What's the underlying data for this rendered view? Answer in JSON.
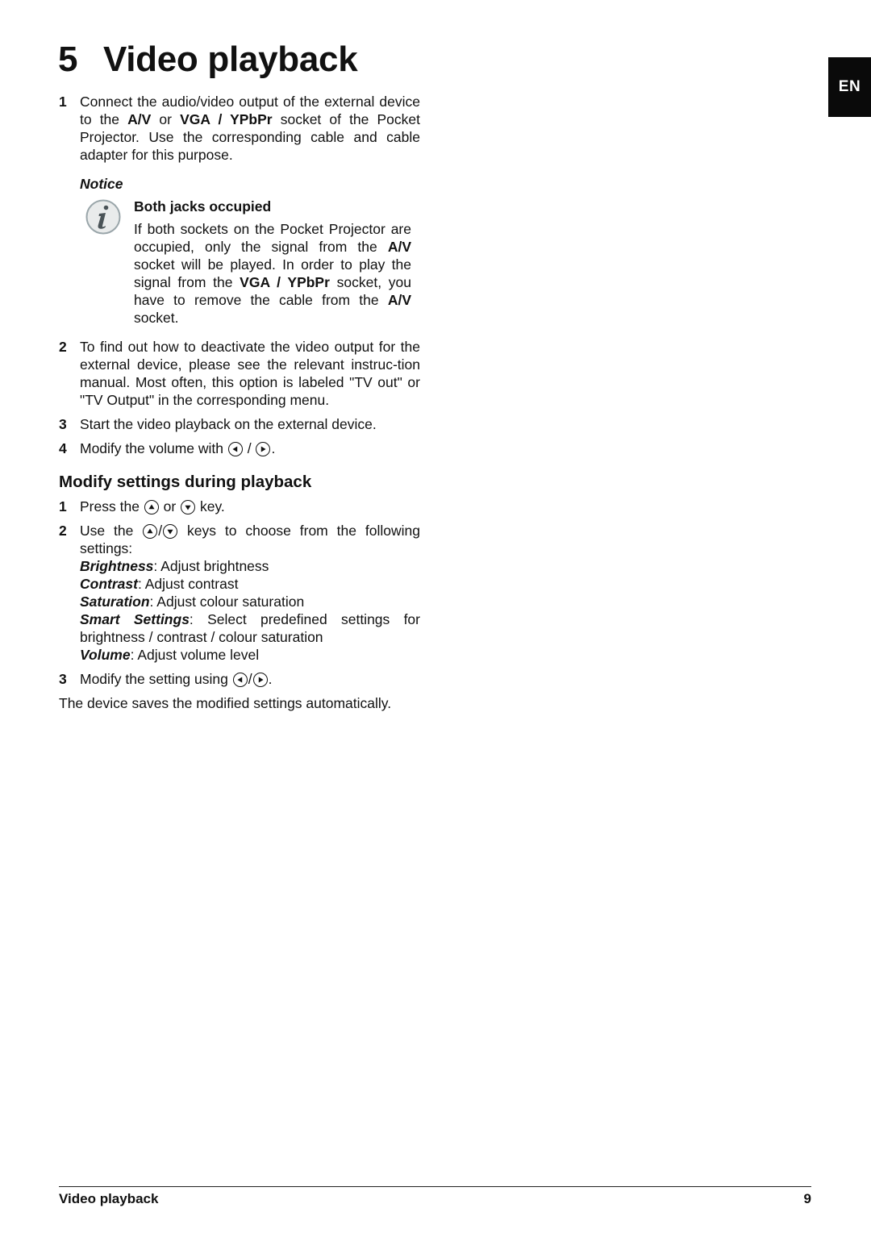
{
  "page": {
    "chapter_number": "5",
    "chapter_title": "Video playback",
    "language_tab": "EN"
  },
  "steps_intro": [
    {
      "n": "1",
      "parts": [
        {
          "t": "Connect the audio/video output of the external device to the ",
          "s": "normal"
        },
        {
          "t": "A/V",
          "s": "bold"
        },
        {
          "t": " or ",
          "s": "normal"
        },
        {
          "t": "VGA / YPbPr",
          "s": "bold"
        },
        {
          "t": "  socket of the Pocket Projector. Use the corresponding cable and cable adapter for this purpose.",
          "s": "normal"
        }
      ]
    }
  ],
  "notice": {
    "label": "Notice",
    "icon": "info-icon",
    "title": "Both jacks occupied",
    "body": [
      {
        "t": "If both sockets on the Pocket Projector are occupied, only the signal from the ",
        "s": "normal"
      },
      {
        "t": "A/V",
        "s": "bold"
      },
      {
        "t": " socket will be played. In order to play the signal from the ",
        "s": "normal"
      },
      {
        "t": "VGA / YPbPr",
        "s": "bold"
      },
      {
        "t": " socket, you have to remove the cable from the ",
        "s": "normal"
      },
      {
        "t": "A/V",
        "s": "bold"
      },
      {
        "t": " socket.",
        "s": "normal"
      }
    ]
  },
  "steps_main": [
    {
      "n": "2",
      "text": "To find out how to deactivate the video output for the external device, please see the relevant instruc-tion manual. Most often, this option is labeled \"TV out\" or \"TV Output\" in the corresponding menu."
    },
    {
      "n": "3",
      "text": "Start the video playback on the external device."
    },
    {
      "n": "4",
      "text_before": "Modify the volume with ",
      "sep": " / ",
      "text_after": ".",
      "keys": [
        "left-key-icon",
        "right-key-icon"
      ]
    }
  ],
  "section": {
    "heading": "Modify settings during playback",
    "step1": {
      "n": "1",
      "before": "Press the ",
      "middle": " or ",
      "after": " key.",
      "keys": [
        "up-key-icon",
        "down-key-icon"
      ]
    },
    "step2": {
      "n": "2",
      "before": "Use the ",
      "sep": "/",
      "after": " keys to choose from the following settings:",
      "keys": [
        "up-key-icon",
        "down-key-icon"
      ]
    },
    "settings": [
      {
        "name": "Brightness",
        "desc": ": Adjust brightness"
      },
      {
        "name": "Contrast",
        "desc": ": Adjust contrast"
      },
      {
        "name": "Saturation",
        "desc": ": Adjust colour saturation"
      },
      {
        "name": "Smart Settings",
        "desc": ": Select predefined settings for"
      },
      {
        "name": "",
        "desc": "brightness / contrast / colour saturation"
      },
      {
        "name": "Volume",
        "desc": ": Adjust volume level"
      }
    ],
    "step3": {
      "n": "3",
      "before": "Modify the setting using ",
      "sep": "/",
      "after": ".",
      "keys": [
        "left-key-icon",
        "right-key-icon"
      ]
    },
    "closing": "The device saves the modified settings automatically."
  },
  "footer": {
    "section_name": "Video playback",
    "page_number": "9"
  }
}
